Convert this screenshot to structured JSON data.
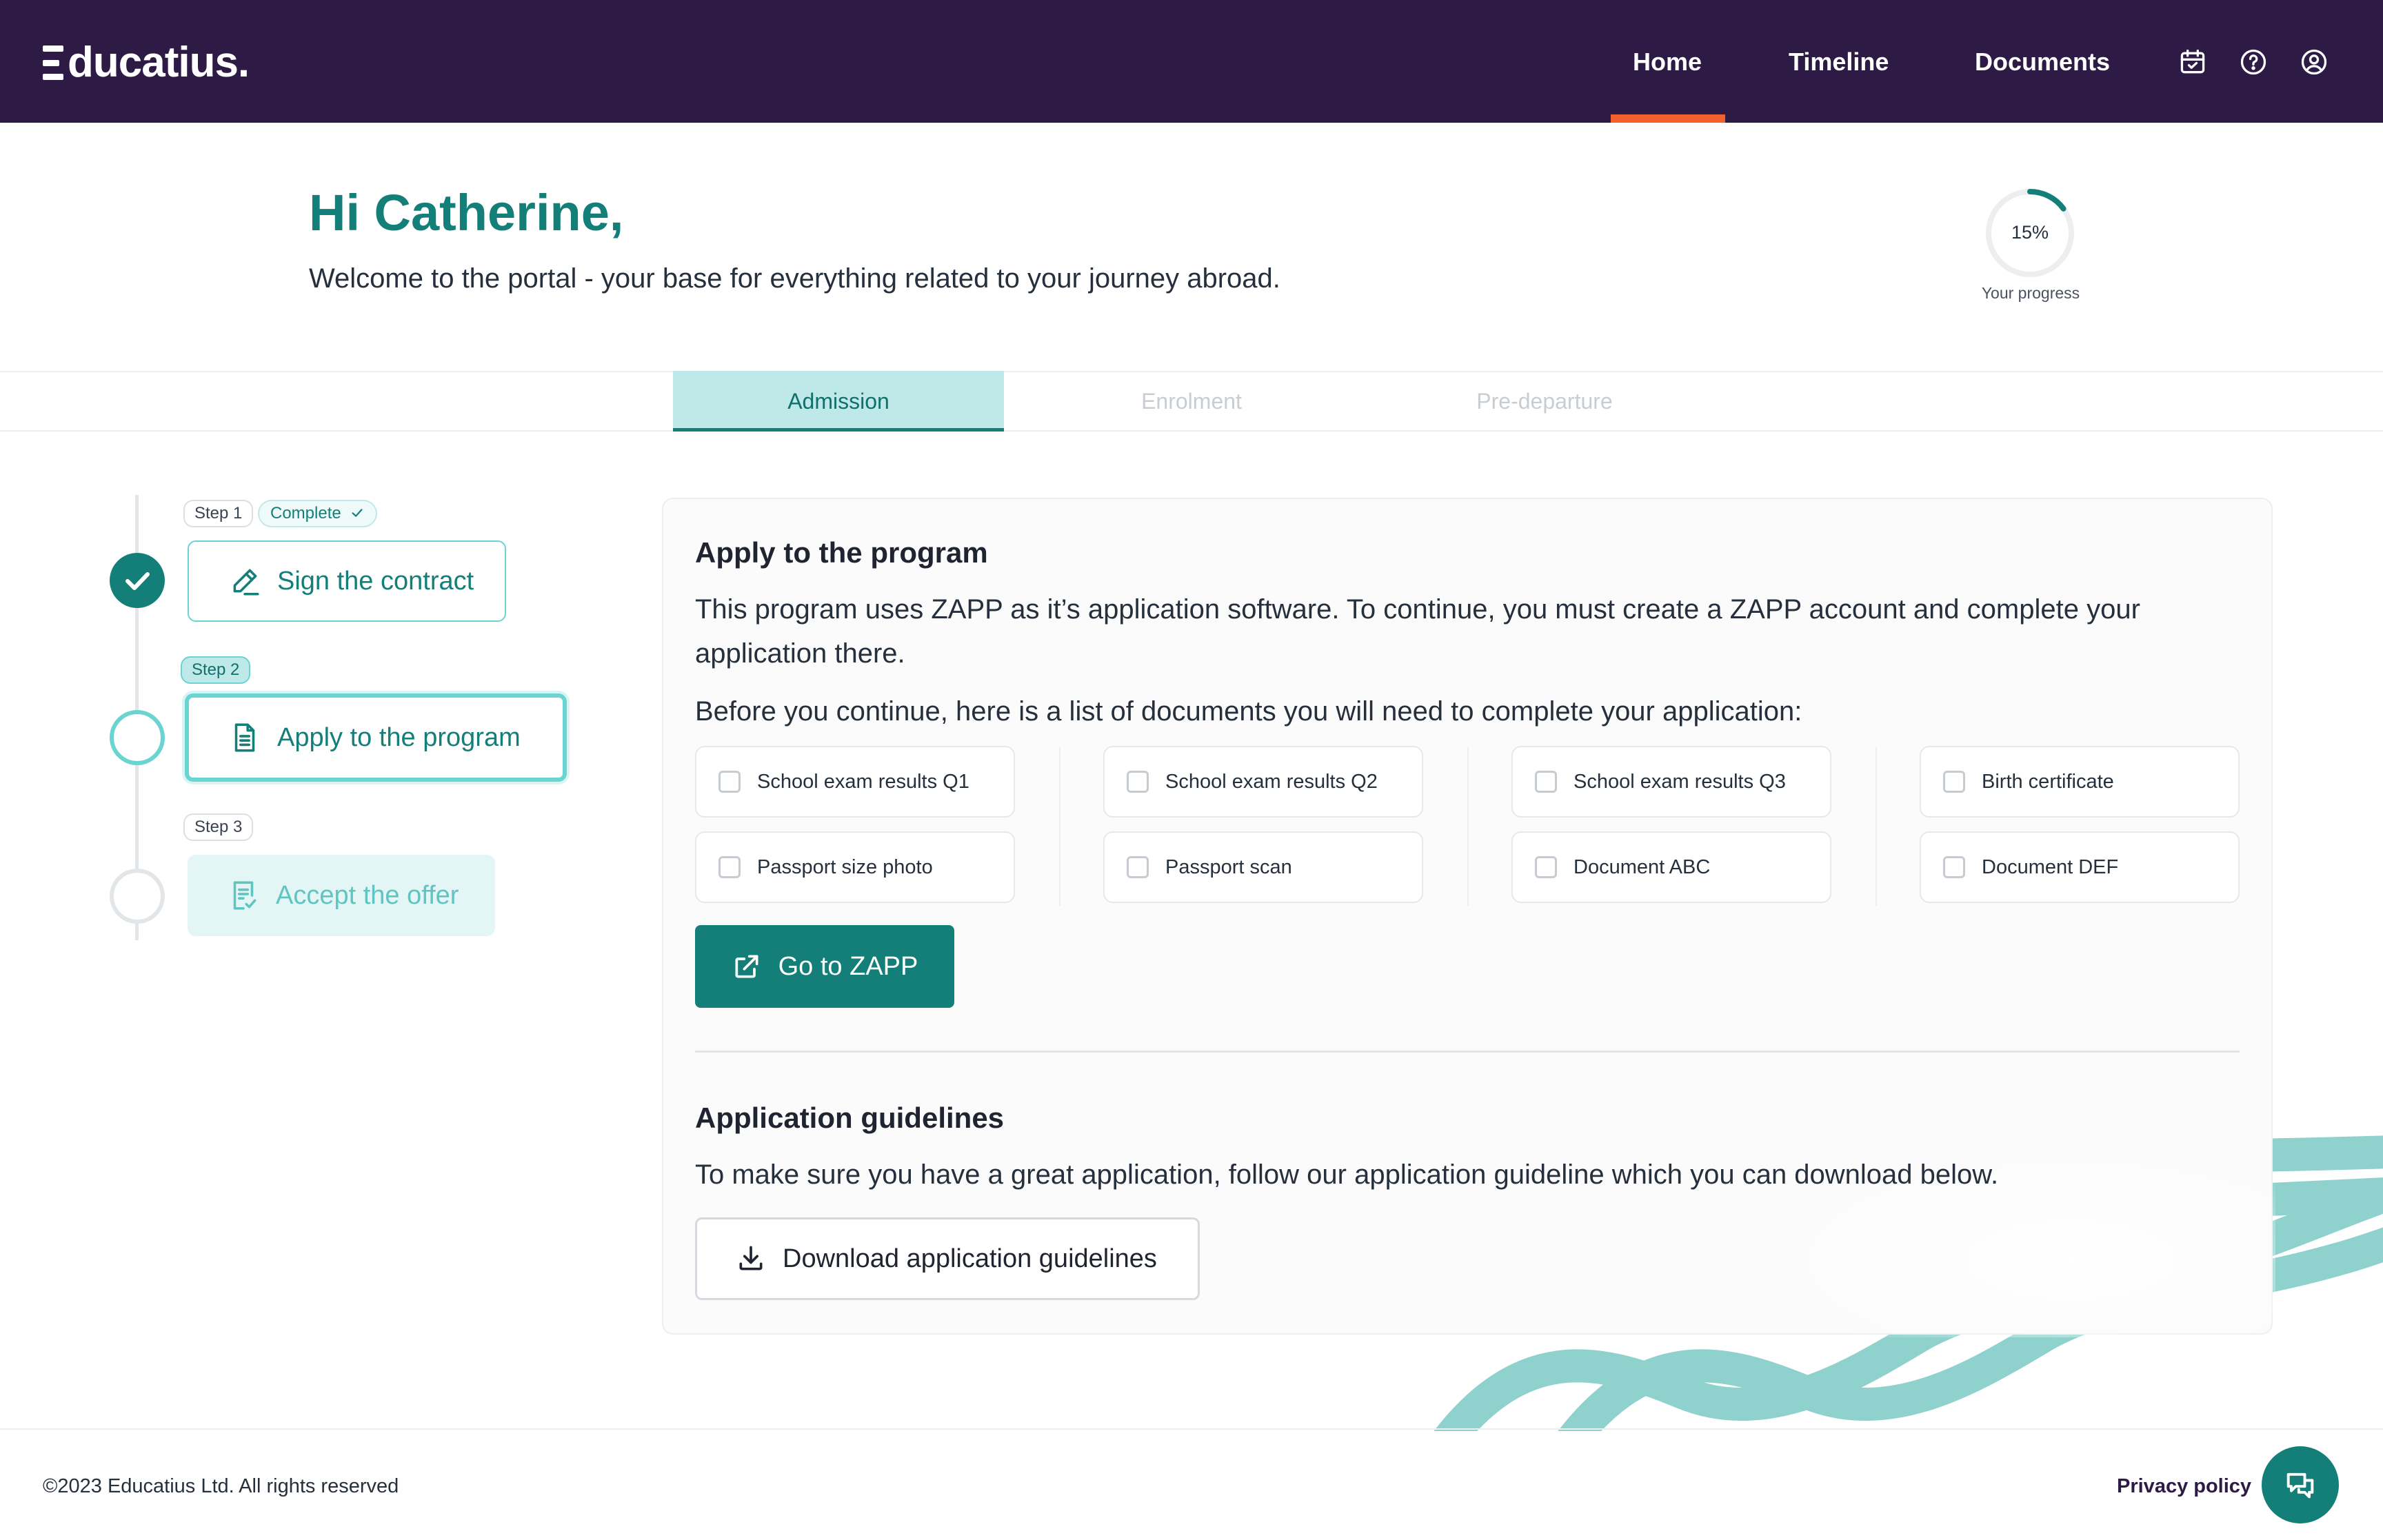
{
  "brand": {
    "name": "Educatius",
    "logo_text": "ducatius."
  },
  "nav": {
    "items": [
      {
        "label": "Home",
        "active": true
      },
      {
        "label": "Timeline",
        "active": false
      },
      {
        "label": "Documents",
        "active": false
      }
    ],
    "icons": [
      "calendar-icon",
      "help-icon",
      "account-icon"
    ]
  },
  "hero": {
    "greeting": "Hi Catherine,",
    "welcome": "Welcome to the portal - your base for everything related to your journey abroad."
  },
  "progress": {
    "value_text": "15%",
    "value": 0.15,
    "label": "Your progress"
  },
  "tabs": [
    {
      "label": "Admission",
      "active": true
    },
    {
      "label": "Enrolment",
      "active": false
    },
    {
      "label": "Pre-departure",
      "active": false
    }
  ],
  "steps": [
    {
      "tag": "Step 1",
      "badge": "Complete",
      "label": "Sign the contract",
      "state": "complete"
    },
    {
      "tag": "Step 2",
      "label": "Apply to the program",
      "state": "current"
    },
    {
      "tag": "Step 3",
      "label": "Accept the offer",
      "state": "upcoming"
    }
  ],
  "apply": {
    "title": "Apply to the program",
    "intro": "This program uses ZAPP as it’s application software. To continue, you must create a ZAPP account and complete your application there.",
    "docs_intro": "Before you continue, here is a list of documents you will need to complete your application:",
    "documents": [
      "School exam results Q1",
      "School exam results Q2",
      "School exam results Q3",
      "Birth certificate",
      "Passport size photo",
      "Passport scan",
      "Document ABC",
      "Document DEF"
    ],
    "button_label": "Go to ZAPP"
  },
  "guidelines": {
    "title": "Application guidelines",
    "text": "To make sure you have a great application, follow our application guideline which you can download below.",
    "button_label": "Download application guidelines"
  },
  "footer": {
    "copyright": "©2023 Educatius Ltd. All rights reserved",
    "privacy_label": "Privacy policy"
  },
  "colors": {
    "header_bg": "#2d1b45",
    "brand_teal": "#147f78",
    "accent_light": "#6ad4d2",
    "nav_active_underline": "#f2612d"
  }
}
